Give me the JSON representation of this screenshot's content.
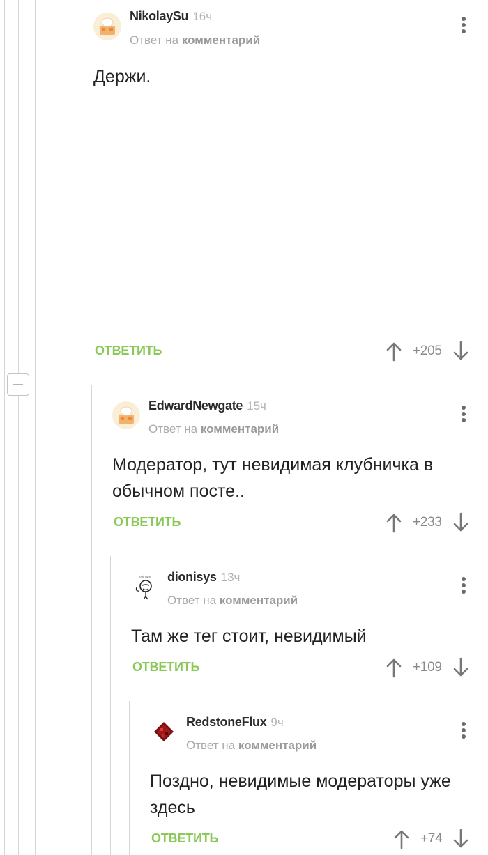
{
  "comments": [
    {
      "author": "NikolaySu",
      "time": "16ч",
      "reply_prefix": "Ответ на",
      "reply_link": "комментарий",
      "text": "Держи.",
      "reply_label": "ОТВЕТИТЬ",
      "rating": "+205",
      "avatar": "chef-hat-avatar"
    },
    {
      "author": "EdwardNewgate",
      "time": "15ч",
      "reply_prefix": "Ответ на",
      "reply_link": "комментарий",
      "text": "Модератор, тут невидимая клубничка в обычном посте..",
      "reply_label": "ОТВЕТИТЬ",
      "rating": "+233",
      "avatar": "chef-hat-avatar"
    },
    {
      "author": "dionisys",
      "time": "13ч",
      "reply_prefix": "Ответ на",
      "reply_link": "комментарий",
      "text": "Там же тег стоит, невидимый",
      "reply_label": "ОТВЕТИТЬ",
      "rating": "+109",
      "avatar": "stick-figure-avatar"
    },
    {
      "author": "RedstoneFlux",
      "time": "9ч",
      "reply_prefix": "Ответ на",
      "reply_link": "комментарий",
      "text": "Поздно, невидимые модераторы уже здесь",
      "reply_label": "ОТВЕТИТЬ",
      "rating": "+74",
      "avatar": "redstone-avatar"
    }
  ],
  "colors": {
    "accent_green": "#8ac858",
    "thread_line": "#d6d6d6",
    "muted_text": "#aaaaaa"
  }
}
